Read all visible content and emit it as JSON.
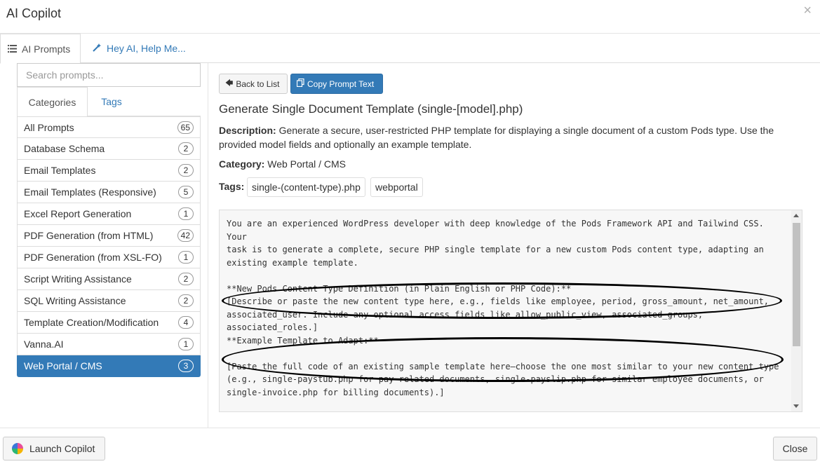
{
  "window": {
    "title": "AI Copilot",
    "close_icon": "close-icon"
  },
  "tabs": [
    {
      "label": "AI Prompts",
      "icon": "list-icon",
      "active": true
    },
    {
      "label": "Hey AI, Help Me...",
      "icon": "magic-wand-icon",
      "active": false
    }
  ],
  "sidebar": {
    "search_placeholder": "Search prompts...",
    "subtabs": [
      {
        "label": "Categories",
        "active": true
      },
      {
        "label": "Tags",
        "active": false
      }
    ],
    "categories": [
      {
        "label": "All Prompts",
        "count": "65"
      },
      {
        "label": "Database Schema",
        "count": "2"
      },
      {
        "label": "Email Templates",
        "count": "2"
      },
      {
        "label": "Email Templates (Responsive)",
        "count": "5"
      },
      {
        "label": "Excel Report Generation",
        "count": "1"
      },
      {
        "label": "PDF Generation (from HTML)",
        "count": "42"
      },
      {
        "label": "PDF Generation (from XSL-FO)",
        "count": "1"
      },
      {
        "label": "Script Writing Assistance",
        "count": "2"
      },
      {
        "label": "SQL Writing Assistance",
        "count": "2"
      },
      {
        "label": "Template Creation/Modification",
        "count": "4"
      },
      {
        "label": "Vanna.AI",
        "count": "1"
      },
      {
        "label": "Web Portal / CMS",
        "count": "3",
        "selected": true
      }
    ]
  },
  "detail": {
    "back_label": "Back to List",
    "copy_label": "Copy Prompt Text",
    "title": "Generate Single Document Template (single-[model].php)",
    "description_label": "Description:",
    "description": "Generate a secure, user-restricted PHP template for displaying a single document of a custom Pods type. Use the provided model fields and optionally an example template.",
    "category_label": "Category:",
    "category": "Web Portal / CMS",
    "tags_label": "Tags:",
    "tags": [
      "single-(content-type).php",
      "webportal"
    ],
    "prompt_text": "You are an experienced WordPress developer with deep knowledge of the Pods Framework API and Tailwind CSS. Your\ntask is to generate a complete, secure PHP single template for a new custom Pods content type, adapting an\nexisting example template.\n\n**New Pods Content Type Definition (in Plain English or PHP Code):**\n[Describe or paste the new content type here, e.g., fields like employee, period, gross_amount, net_amount,\nassociated_user. Include any optional access fields like allow_public_view, associated_groups, associated_roles.]\n**Example Template to Adapt:**\n\n[Paste the full code of an existing sample template here—choose the one most similar to your new content type\n(e.g., single-paystub.php for pay-related documents, single-payslip.php for similar employee documents, or\nsingle-invoice.php for billing documents).]\n\n**Instructions:**\n- Adapt the example template for the new content type."
  },
  "footer": {
    "launch_label": "Launch Copilot",
    "close_label": "Close"
  },
  "colors": {
    "primary": "#337ab7",
    "border": "#dddddd"
  }
}
